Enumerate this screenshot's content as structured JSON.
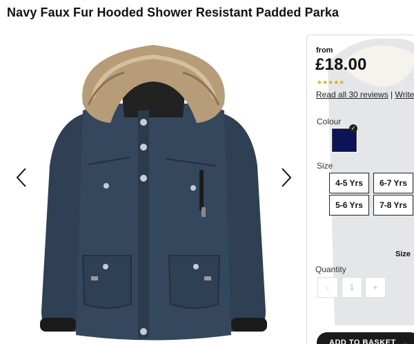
{
  "product": {
    "title": "Navy Faux Fur Hooded Shower Resistant Padded Parka"
  },
  "pricing": {
    "from_label": "from",
    "price": "£18.00",
    "rating": 5,
    "stars": "★★★★★"
  },
  "reviews": {
    "link_text": "Read all 30 reviews",
    "separator": " | ",
    "write_text": "Write"
  },
  "colour": {
    "label": "Colour",
    "selected_hex": "#0b1458"
  },
  "size": {
    "label": "Size",
    "options": [
      "4-5 Yrs",
      "6-7 Yrs",
      "5-6 Yrs",
      "7-8 Yrs"
    ],
    "guide_label": "Size"
  },
  "quantity": {
    "label": "Quantity",
    "minus": "-",
    "value": "1",
    "plus": "+"
  },
  "basket": {
    "label": "ADD TO BASKET"
  },
  "icons": {
    "prev": "chevron-left-icon",
    "next": "chevron-right-icon",
    "selected": "check-icon",
    "basket_arrow": "arrow-right-icon"
  }
}
